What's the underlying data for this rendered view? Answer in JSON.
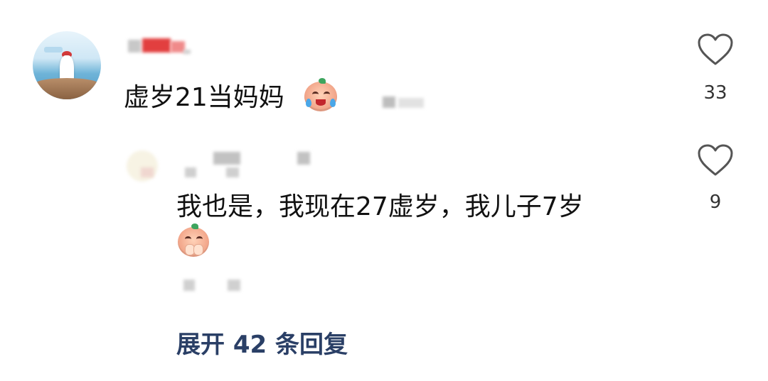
{
  "comment": {
    "text": "虚岁21当妈妈",
    "emoji_icon": "crying-peach-emoji-icon",
    "likes": "33"
  },
  "reply": {
    "text": "我也是，我现在27虚岁，我儿子7岁",
    "emoji_icon": "praying-peach-emoji-icon",
    "likes": "9"
  },
  "expand_replies": {
    "label": "展开 42 条回复"
  },
  "colors": {
    "text": "#111111",
    "expand_link": "#2a3f66",
    "heart_stroke": "#555555"
  }
}
